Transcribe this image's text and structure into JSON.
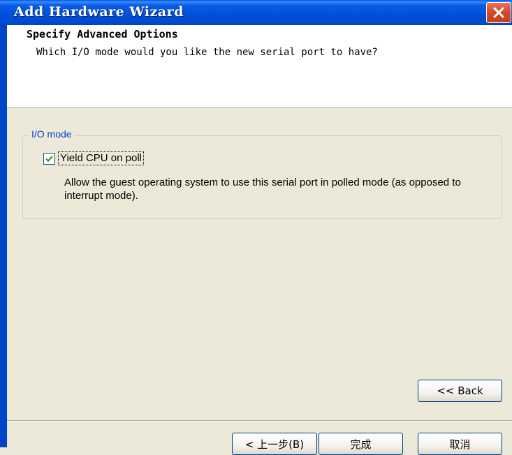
{
  "window": {
    "title": "Add Hardware Wizard"
  },
  "header": {
    "title": "Specify Advanced Options",
    "subtitle": "Which I/O mode would you like the new serial port to have?"
  },
  "io_mode": {
    "group_label": "I/O mode",
    "checkbox_label": "Yield CPU on poll",
    "checked": true,
    "description": "Allow the guest operating system to use this serial port in polled mode (as opposed to interrupt mode)."
  },
  "buttons": {
    "back_inner": "<< Back",
    "back_prev": "< 上一步(B)",
    "finish": "完成",
    "cancel": "取消"
  },
  "colors": {
    "titlebar": "#0050d8",
    "close": "#d24a28",
    "face": "#ece9d8",
    "group_label": "#0046d5"
  }
}
